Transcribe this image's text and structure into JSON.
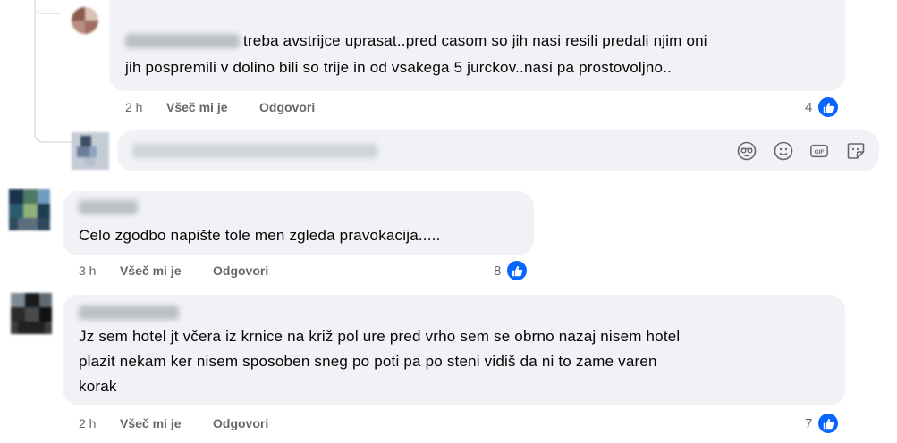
{
  "comments": [
    {
      "author_redacted": true,
      "text_lines": [
        "treba avstrijce uprasat..pred casom so jih nasi resili predali njim oni",
        "jih pospremili v dolino bili so trije in od vsakega 5 jurckov..nasi pa prostovoljno.."
      ],
      "time": "2 h",
      "like_action": "Všeč mi je",
      "reply_action": "Odgovori",
      "reactions": "4"
    },
    {
      "author_redacted": true,
      "text_lines": [
        "Celo zgodbo napište tole men zgleda pravokacija....."
      ],
      "time": "3 h",
      "like_action": "Všeč mi je",
      "reply_action": "Odgovori",
      "reactions": "8"
    },
    {
      "author_redacted": true,
      "text_lines": [
        "Jz sem hotel jt včera iz krnice na križ pol ure pred vrho sem se obrno nazaj nisem hotel",
        "plazit nekam ker nisem sposoben sneg po poti pa po steni vidiš da ni to zame varen",
        "korak"
      ],
      "time": "2 h",
      "like_action": "Všeč mi je",
      "reply_action": "Odgovori",
      "reactions": "7"
    }
  ],
  "reply_input": {
    "placeholder_redacted": true,
    "icons": [
      "avatar-sticker-icon",
      "emoji-icon",
      "gif-icon",
      "sticker-icon"
    ]
  },
  "colors": {
    "like_blue": "#0866ff",
    "bubble_bg": "#f0f2f5",
    "meta_gray": "#65676b"
  }
}
